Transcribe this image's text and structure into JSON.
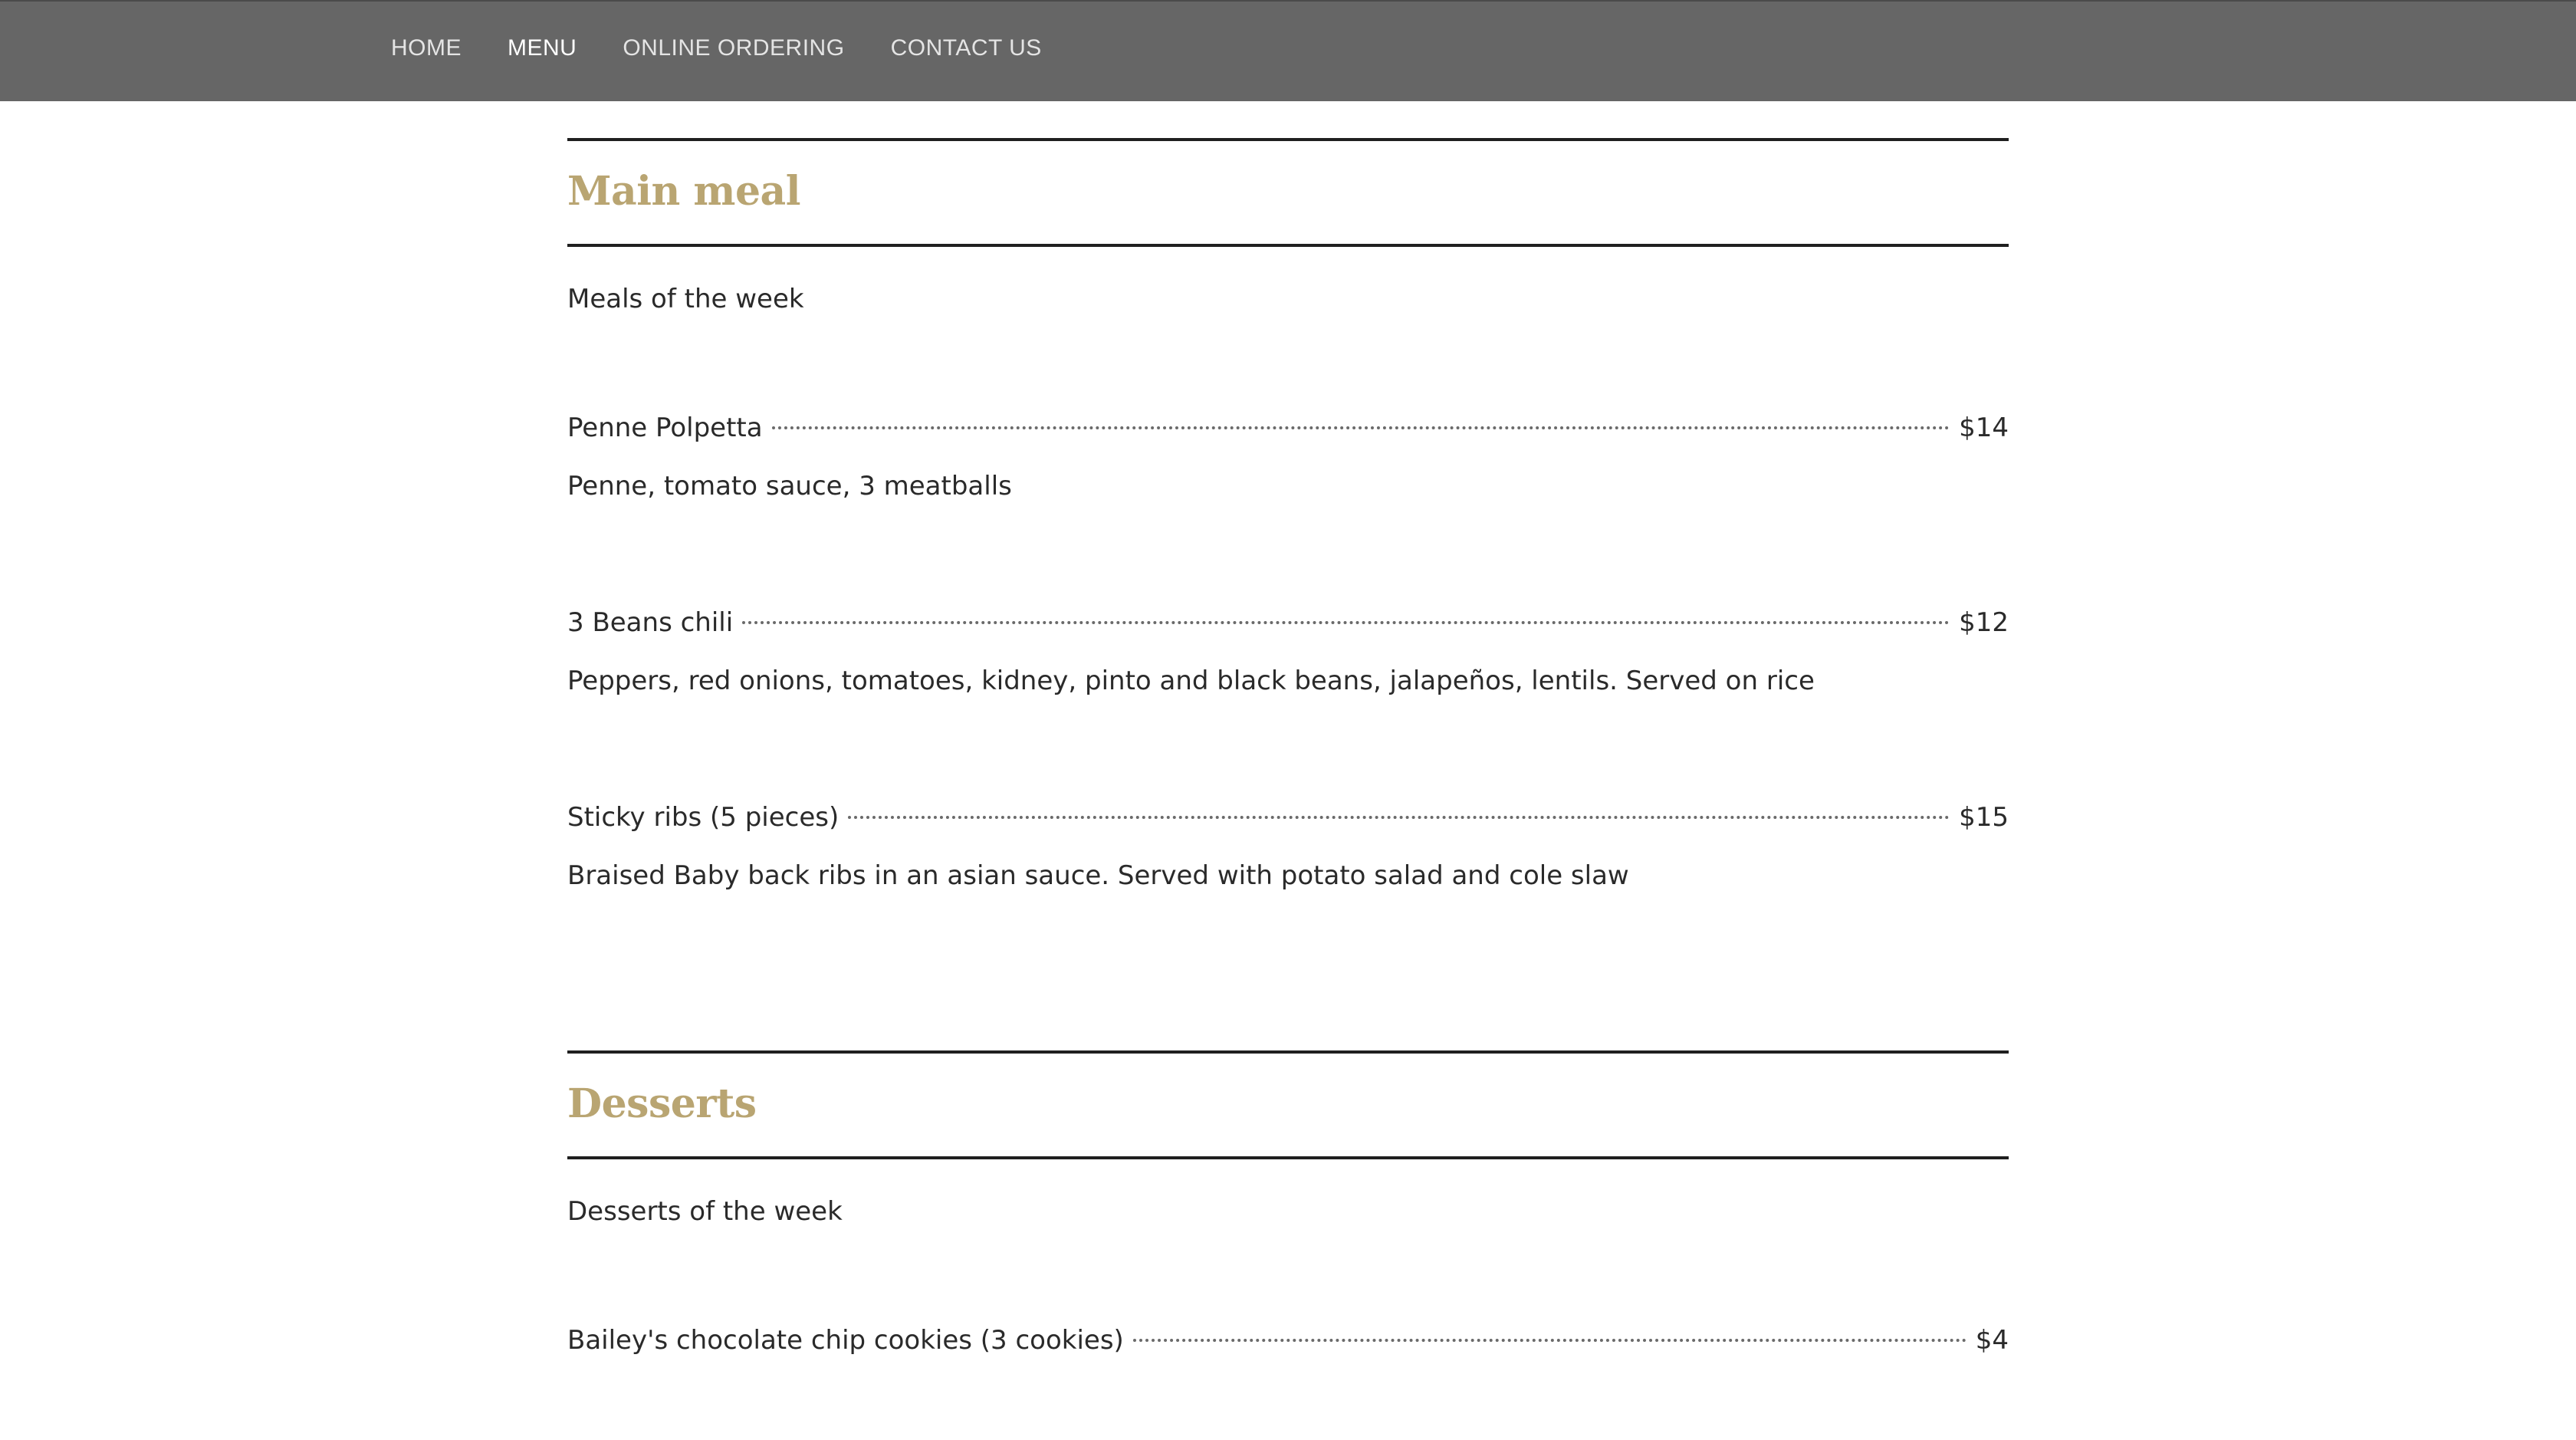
{
  "nav": {
    "items": [
      {
        "label": "HOME",
        "active": false
      },
      {
        "label": "MENU",
        "active": true
      },
      {
        "label": "ONLINE ORDERING",
        "active": false
      },
      {
        "label": "CONTACT US",
        "active": false
      }
    ]
  },
  "colors": {
    "nav_background": "#666666",
    "section_title": "#b9a572",
    "text": "#2a2a2a"
  },
  "sections": [
    {
      "title": "Main meal",
      "description": "Meals of the week",
      "items": [
        {
          "name": "Penne Polpetta",
          "price": "$14",
          "description": "Penne, tomato sauce, 3 meatballs"
        },
        {
          "name": "3 Beans chili",
          "price": "$12",
          "description": "Peppers, red onions, tomatoes, kidney, pinto and black beans, jalapeños, lentils. Served on rice"
        },
        {
          "name": "Sticky ribs (5 pieces) ",
          "price": "$15",
          "description": "Braised Baby back ribs in an asian sauce. Served with potato salad and cole slaw"
        }
      ]
    },
    {
      "title": "Desserts",
      "description": "Desserts of the week",
      "items": [
        {
          "name": "Bailey's chocolate chip cookies (3 cookies)",
          "price": "$4"
        }
      ]
    }
  ]
}
